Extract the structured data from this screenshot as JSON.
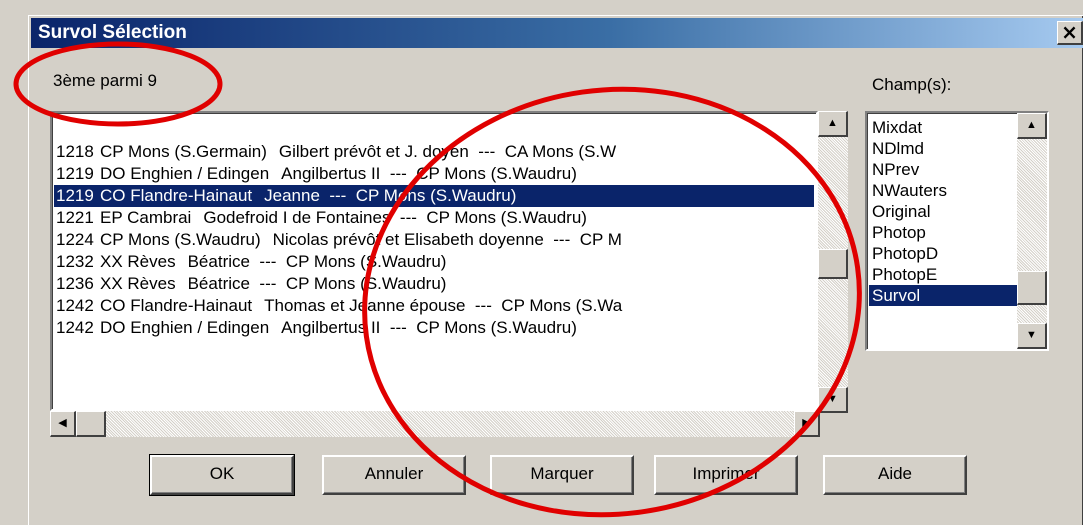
{
  "window": {
    "title": "Survol Sélection",
    "close_glyph": "×"
  },
  "position_label": "3ème parmi 9",
  "fields_label": "Champ(s):",
  "records": [
    {
      "year": "1218",
      "origin": "CP Mons (S.Germain)",
      "text": "Gilbert prévôt et J. doyen  ---  CA Mons (S.W"
    },
    {
      "year": "1219",
      "origin": "DO Enghien / Edingen",
      "text": "Angilbertus II  ---  CP Mons (S.Waudru)"
    },
    {
      "year": "1219",
      "origin": "CO Flandre-Hainaut",
      "text": "Jeanne  ---  CP Mons (S.Waudru)",
      "selected": true
    },
    {
      "year": "1221",
      "origin": "EP Cambrai",
      "text": "Godefroid I de Fontaines  ---  CP Mons (S.Waudru)"
    },
    {
      "year": "1224",
      "origin": "CP Mons (S.Waudru)",
      "text": "Nicolas prévôt et Elisabeth doyenne  ---  CP M"
    },
    {
      "year": "1232",
      "origin": "XX Rèves",
      "text": "Béatrice  ---  CP Mons (S.Waudru)"
    },
    {
      "year": "1236",
      "origin": "XX Rèves",
      "text": "Béatrice  ---  CP Mons (S.Waudru)"
    },
    {
      "year": "1242",
      "origin": "CO Flandre-Hainaut",
      "text": "Thomas et Jeanne épouse  ---  CP Mons (S.Wa"
    },
    {
      "year": "1242",
      "origin": "DO Enghien / Edingen",
      "text": "Angilbertus II  ---  CP Mons (S.Waudru)"
    }
  ],
  "fields": [
    {
      "label": "Mixdat"
    },
    {
      "label": "NDlmd"
    },
    {
      "label": "NPrev"
    },
    {
      "label": "NWauters"
    },
    {
      "label": "Original"
    },
    {
      "label": "Photop"
    },
    {
      "label": "PhotopD"
    },
    {
      "label": "PhotopE"
    },
    {
      "label": "Survol",
      "selected": true
    }
  ],
  "buttons": {
    "ok": "OK",
    "cancel": "Annuler",
    "mark": "Marquer",
    "print": "Imprimer",
    "help": "Aide"
  },
  "glyphs": {
    "up": "▲",
    "down": "▼",
    "left": "◀",
    "right": "▶"
  },
  "colors": {
    "selection": "#0a246a",
    "annotation": "#e00000"
  }
}
